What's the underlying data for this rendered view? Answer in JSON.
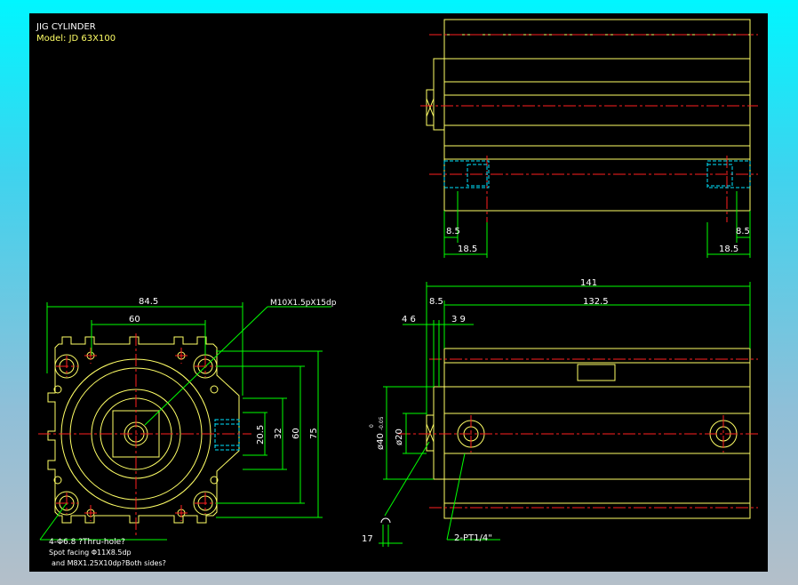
{
  "title": {
    "line1": "JIG CYLINDER",
    "line2": "Model: JD 63X100"
  },
  "colors": {
    "background": "#000000",
    "outline": "#ffff66",
    "dimension": "#00ff00",
    "centerline": "#ff2020",
    "hidden": "#00e5ff",
    "text": "#ffffff"
  },
  "dims": {
    "d84_5": "84.5",
    "d60w": "60",
    "m10": "M10X1.5pX15dp",
    "d20_5": "20.5",
    "d32": "32",
    "d60h": "60",
    "d75": "75",
    "d141": "141",
    "d8_5a": "8.5",
    "d132_5": "132.5",
    "d4_6": "4 6",
    "d3_9": "3 9",
    "phi40": "ø40",
    "tol_top": "0",
    "tol_bot": "-0.05",
    "phi20": "ø20",
    "d17": "17",
    "pt": "2-PT1/4\"",
    "top_l_85": "8.5",
    "top_l_185": "18.5",
    "top_r_85": "8.5",
    "top_r_185": "18.5"
  },
  "notes": {
    "hole": "4-Φ6.8 ?Thru-hole?",
    "spot": "Spot facing Φ11X8.5dp",
    "thread": "and M8X1.25X10dp?Both sides?"
  },
  "icons": {
    "label_plate": "label-plate-icon"
  }
}
